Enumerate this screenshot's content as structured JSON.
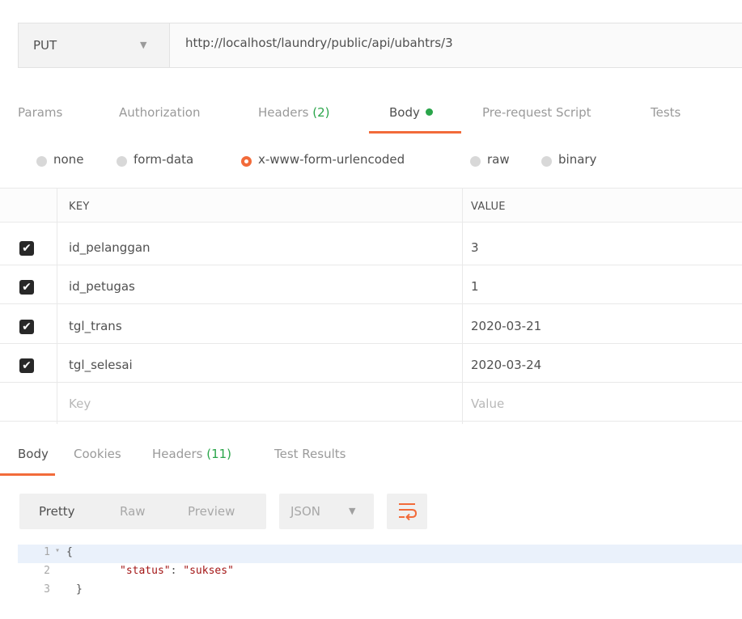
{
  "request": {
    "method": "PUT",
    "url": "http://localhost/laundry/public/api/ubahtrs/3"
  },
  "request_tabs": {
    "params": "Params",
    "authorization": "Authorization",
    "headers": "Headers",
    "headers_count": "(2)",
    "body": "Body",
    "prerequest": "Pre-request Script",
    "tests": "Tests"
  },
  "body_types": {
    "none": "none",
    "form_data": "form-data",
    "urlencoded": "x-www-form-urlencoded",
    "raw": "raw",
    "binary": "binary",
    "selected": "x-www-form-urlencoded"
  },
  "table": {
    "key_header": "KEY",
    "value_header": "VALUE",
    "rows": [
      {
        "key": "id_pelanggan",
        "value": "3",
        "checked": true
      },
      {
        "key": "id_petugas",
        "value": "1",
        "checked": true
      },
      {
        "key": "tgl_trans",
        "value": "2020-03-21",
        "checked": true
      },
      {
        "key": "tgl_selesai",
        "value": "2020-03-24",
        "checked": true
      }
    ],
    "key_placeholder": "Key",
    "value_placeholder": "Value",
    "check_glyph": "✔"
  },
  "response_tabs": {
    "body": "Body",
    "cookies": "Cookies",
    "headers": "Headers",
    "headers_count": "(11)",
    "test_results": "Test Results"
  },
  "format": {
    "pretty": "Pretty",
    "raw": "Raw",
    "preview": "Preview",
    "language": "JSON"
  },
  "icons": {
    "caret": "▼",
    "fold": "▾",
    "wrap": "wrap-lines-icon"
  },
  "colors": {
    "accent": "#f26b3a",
    "green": "#2aa54a"
  },
  "code": {
    "lines": [
      {
        "num": "1",
        "text": "{"
      },
      {
        "num": "2",
        "key": "\"status\"",
        "sep": ": ",
        "val": "\"sukses\""
      },
      {
        "num": "3",
        "text": "}"
      }
    ]
  }
}
